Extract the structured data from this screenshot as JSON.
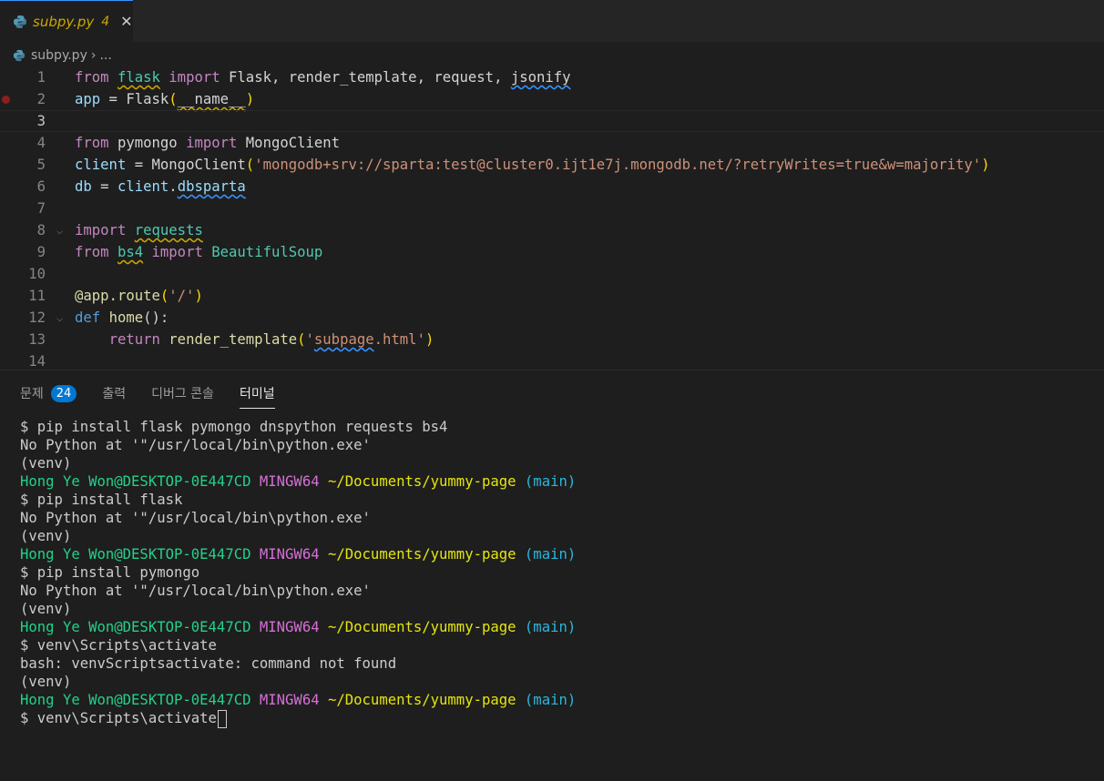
{
  "tab": {
    "filename": "subpy.py",
    "problem_count": "4",
    "close_glyph": "✕"
  },
  "breadcrumb": {
    "file": "subpy.py",
    "separator": "›",
    "more": "..."
  },
  "editor": {
    "line_numbers": [
      "1",
      "2",
      "3",
      "4",
      "5",
      "6",
      "7",
      "8",
      "9",
      "10",
      "11",
      "12",
      "13",
      "14"
    ],
    "lines": {
      "l1": [
        "from",
        "flask",
        "import",
        "Flask, render_template, request, ",
        "jsonify"
      ],
      "l2": [
        "app",
        " = ",
        "Flask",
        "(",
        "__name__",
        ")"
      ],
      "l4": [
        "from",
        "pymongo",
        "import",
        "MongoClient"
      ],
      "l5": [
        "client",
        " = ",
        "MongoClient",
        "(",
        "'mongodb+srv://sparta:test@cluster0.ijt1e7j.mongodb.net/?retryWrites=true&w=majority'",
        ")"
      ],
      "l6": [
        "db",
        " = ",
        "client",
        ".",
        "dbsparta"
      ],
      "l8": [
        "import",
        "requests"
      ],
      "l9": [
        "from",
        "bs4",
        "import",
        "BeautifulSoup"
      ],
      "l11": [
        "@app.route",
        "(",
        "'/'",
        ")"
      ],
      "l12": [
        "def",
        "home",
        "():"
      ],
      "l13": [
        "return",
        "render_template",
        "(",
        "'",
        "subpage",
        ".html'",
        ")"
      ]
    }
  },
  "panel": {
    "tabs": [
      "문제",
      "출력",
      "디버그 콘솔",
      "터미널"
    ],
    "problems_badge": "24"
  },
  "terminal": {
    "cmd1": "$ pip install flask pymongo dnspython requests bs4",
    "no_python": "No Python at '\"/usr/local/bin\\python.exe'",
    "venv": "(venv)",
    "user": "Hong Ye Won@DESKTOP-0E447CD",
    "mingw": "MINGW64",
    "path": "~/Documents/yummy-page",
    "branch": "(main)",
    "cmd2": "$ pip install flask",
    "cmd3": "$ pip install pymongo",
    "cmd4": "$ venv\\Scripts\\activate",
    "bash_err": "bash: venvScriptsactivate: command not found",
    "cmd5": "$ venv\\Scripts\\activate"
  },
  "colors": {
    "tab_warning": "#cca700",
    "keyword": "#c586c0",
    "string": "#ce9178",
    "terminal_user": "#23d18b",
    "terminal_mingw": "#d670d6",
    "terminal_path": "#e5e510",
    "terminal_branch": "#29b8db",
    "badge": "#0078d4"
  }
}
